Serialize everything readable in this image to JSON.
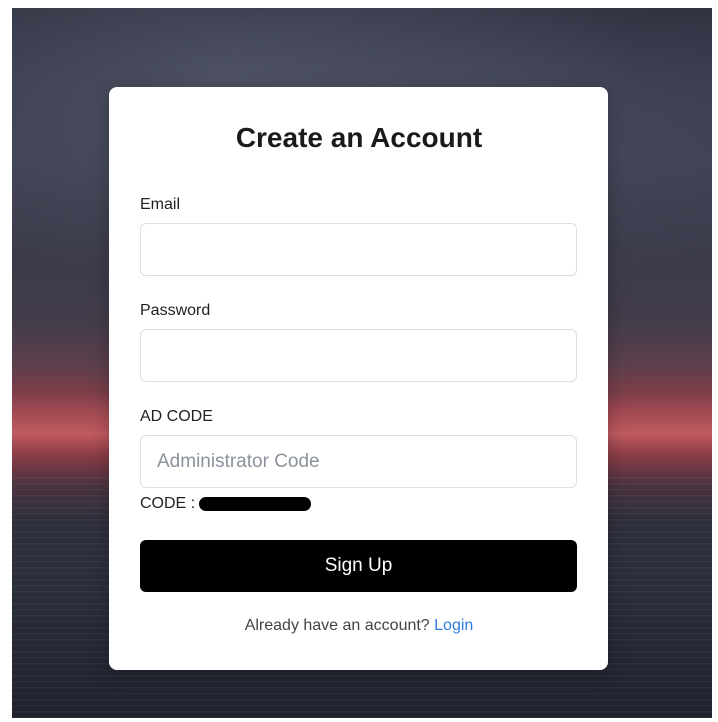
{
  "form": {
    "title": "Create an Account",
    "email_label": "Email",
    "email_value": "",
    "password_label": "Password",
    "password_value": "",
    "adcode_label": "AD CODE",
    "adcode_placeholder": "Administrator Code",
    "code_prefix": "CODE :",
    "submit_label": "Sign Up",
    "footer_text": "Already have an account?",
    "login_link": "Login"
  },
  "colors": {
    "button": "#000000",
    "link": "#2f7de1",
    "card": "#ffffff"
  }
}
